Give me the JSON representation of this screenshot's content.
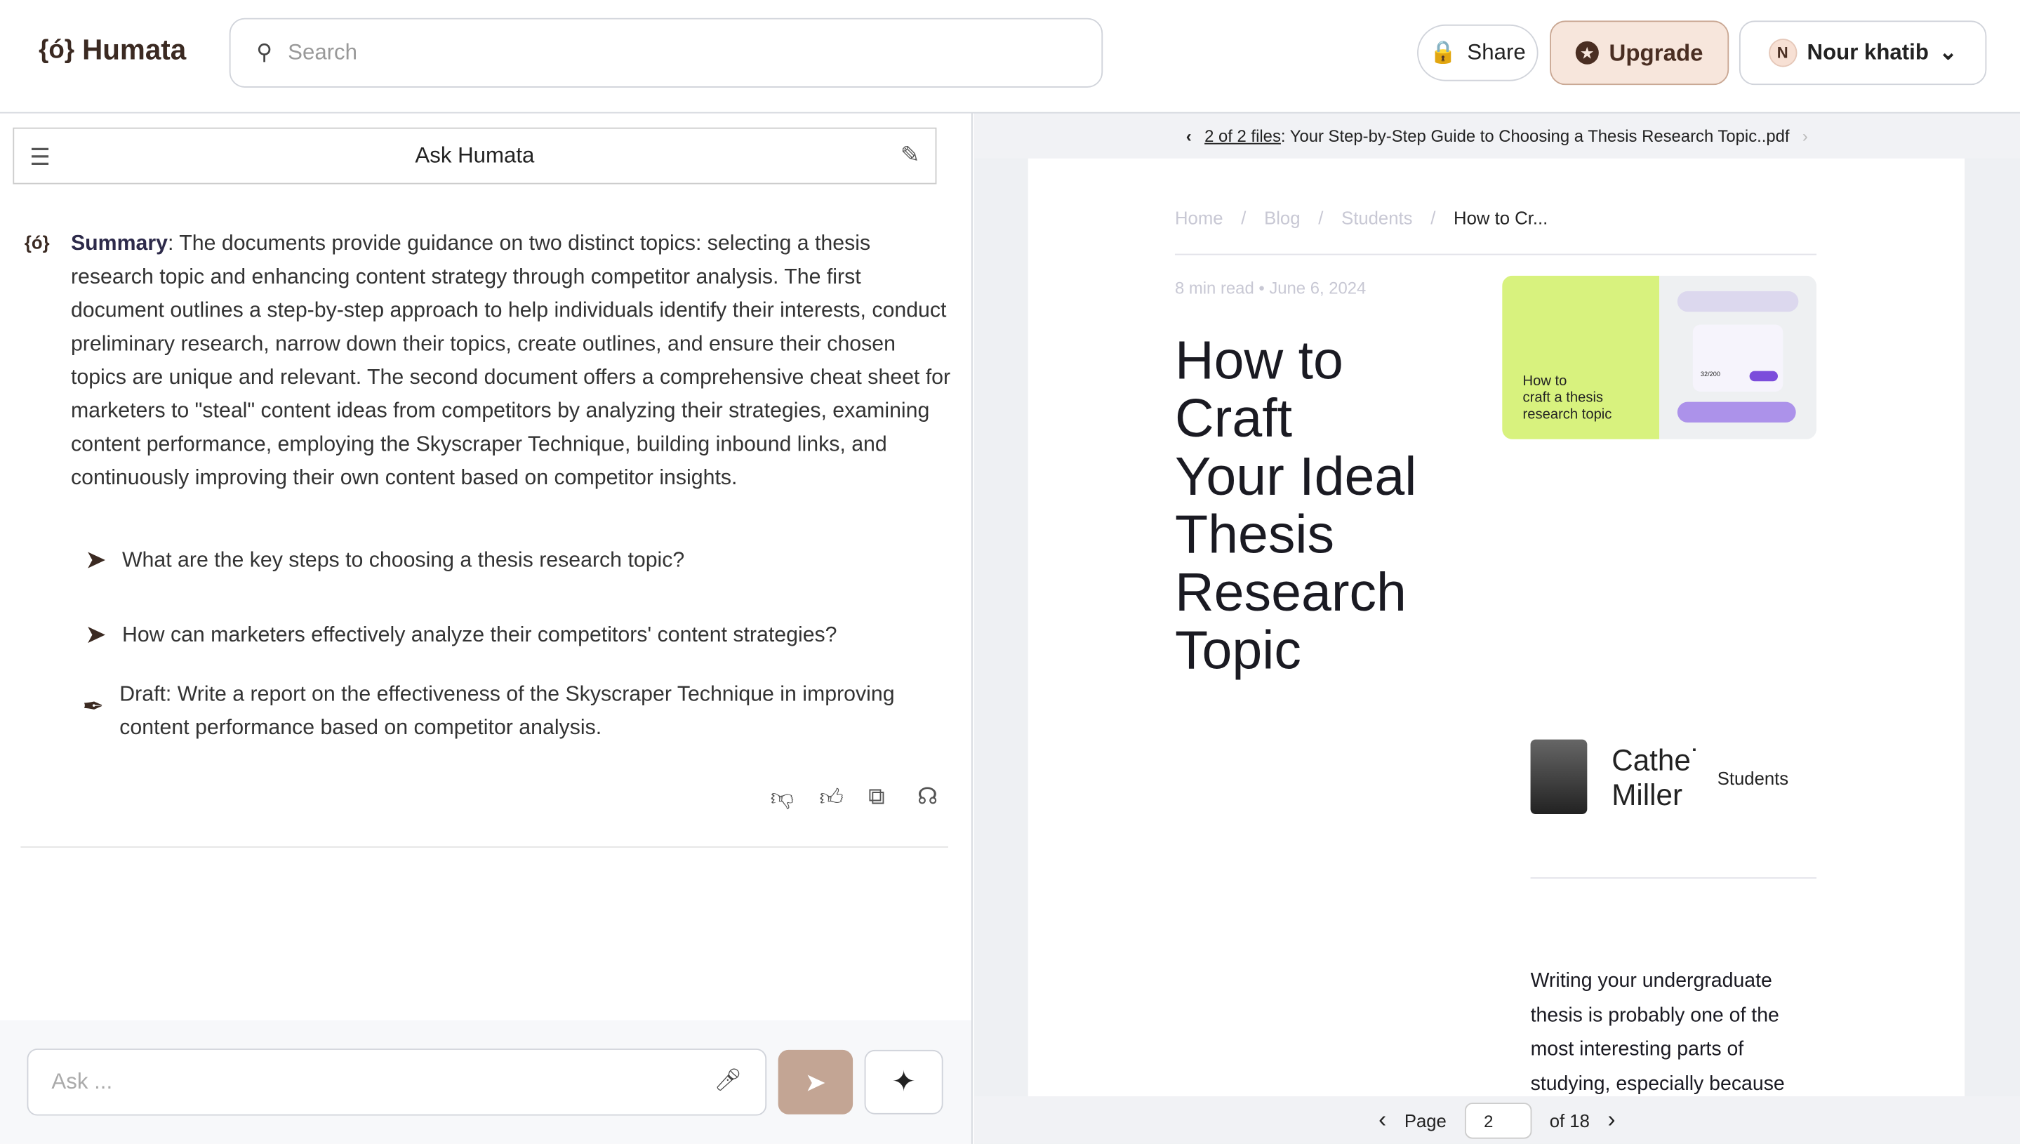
{
  "header": {
    "logo": "Humata",
    "search_placeholder": "Search",
    "share": "Share",
    "upgrade": "Upgrade",
    "user_initial": "N",
    "user_name": "Nour khatib"
  },
  "chat": {
    "title": "Ask Humata",
    "summary_label": "Summary",
    "summary_text": ": The documents provide guidance on two distinct topics: selecting a thesis research topic and enhancing content strategy through competitor analysis. The first document outlines a step-by-step approach to help individuals identify their interests, conduct preliminary research, narrow down their topics, create outlines, and ensure their chosen topics are unique and relevant. The second document offers a comprehensive cheat sheet for marketers to \"steal\" content ideas from competitors by analyzing their strategies, examining content performance, employing the Skyscraper Technique, building inbound links, and continuously improving their own content based on competitor insights.",
    "suggestions": [
      "What are the key steps to choosing a thesis research topic?",
      "How can marketers effectively analyze their competitors' content strategies?"
    ],
    "draft": "Draft: Write a report on the effectiveness of the Skyscraper Technique in improving content performance based on competitor analysis.",
    "ask_placeholder": "Ask ..."
  },
  "viewer": {
    "file_link": "2 of 2 files",
    "file_name": ": Your Step-by-Step Guide to Choosing a Thesis Research Topic..pdf",
    "page_label": "Page",
    "page_value": "2",
    "page_total": "of 18"
  },
  "doc": {
    "breadcrumb": [
      "Home",
      "Blog",
      "Students",
      "How to Cr..."
    ],
    "read_time": "8 min read",
    "date": "June 6, 2024",
    "title_lines": [
      "How to",
      "Craft",
      "Your Ideal",
      "Thesis",
      "Research",
      "Topic"
    ],
    "card_text": [
      "How to",
      "craft a thesis",
      "research topic"
    ],
    "card_counter": "32/200",
    "author_lines": [
      "Cathe˙",
      "Miller"
    ],
    "author_category": "Students",
    "body_lines": [
      "Writing your undergraduate",
      "thesis is probably one of the",
      "most interesting parts of",
      "studying, especially because"
    ]
  }
}
